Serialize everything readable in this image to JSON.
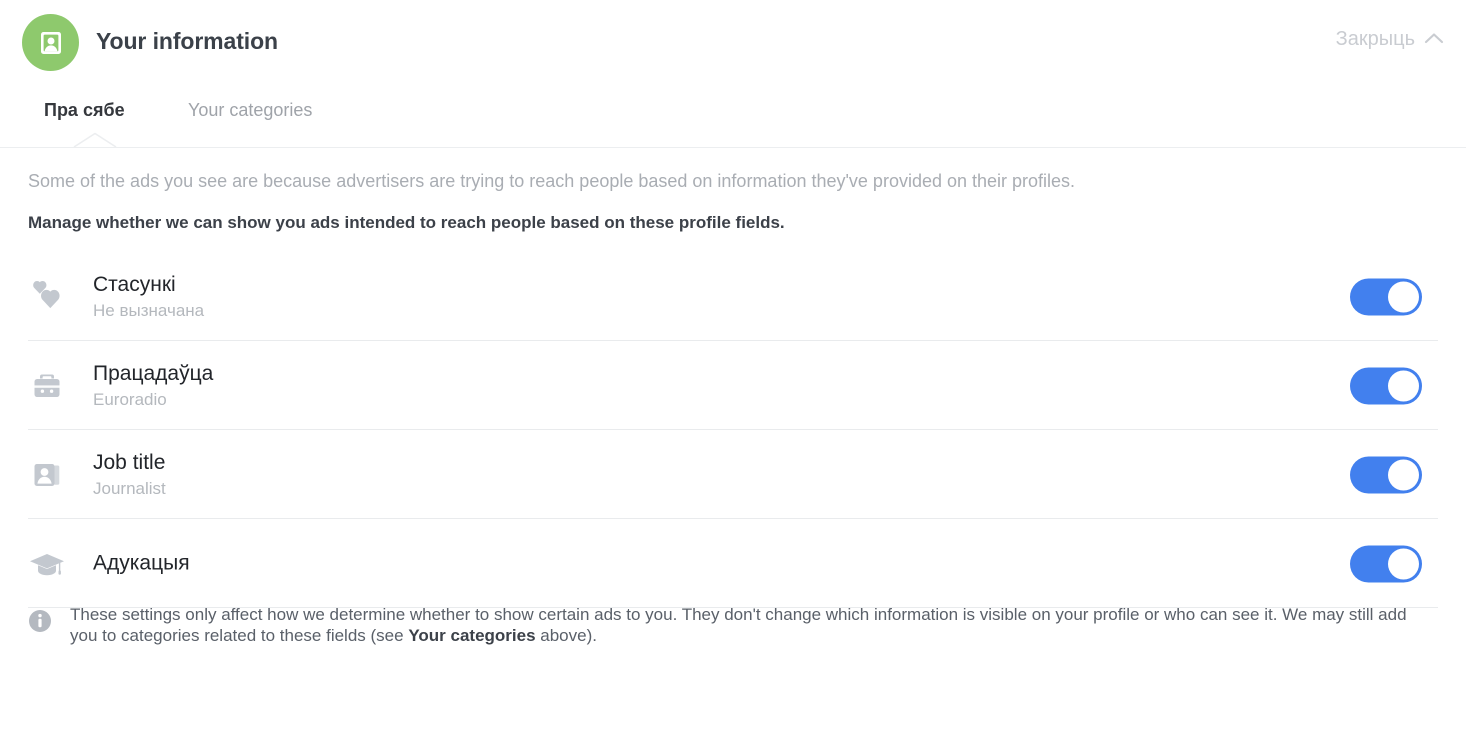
{
  "header": {
    "avatar_icon": "profile-card-icon",
    "avatar_bg": "#8ec96d",
    "title": "Your information",
    "close_label": "Закрыць",
    "close_icon": "chevron-up-icon"
  },
  "tabs": [
    {
      "label": "Пра сябе",
      "active": true
    },
    {
      "label": "Your categories",
      "active": false
    }
  ],
  "intro": {
    "description": "Some of the ads you see are because advertisers are trying to reach people based on information they've provided on their profiles.",
    "subheading": "Manage whether we can show you ads intended to reach people based on these profile fields."
  },
  "rows": [
    {
      "icon": "hearts-icon",
      "title": "Стасункі",
      "subtitle": "Не вызначана",
      "toggle_state": "on"
    },
    {
      "icon": "briefcase-icon",
      "title": "Працадаўца",
      "subtitle": "Euroradio",
      "toggle_state": "on"
    },
    {
      "icon": "id-badge-icon",
      "title": "Job title",
      "subtitle": "Journalist",
      "toggle_state": "on"
    },
    {
      "icon": "graduation-cap-icon",
      "title": "Адукацыя",
      "subtitle": "",
      "toggle_state": "on"
    }
  ],
  "note": {
    "icon": "info-icon",
    "text_part1": "These settings only affect how we determine whether to show certain ads to you. They don't change which information is visible on your profile or who can see it. We may still add you to categories related to these fields (see ",
    "text_bold": "Your categories",
    "text_part2": " above)."
  },
  "colors": {
    "toggle_on": "#4280ee",
    "accent_green": "#8ec96d",
    "text_primary": "#22252a",
    "text_muted": "#b4b8bd",
    "divider": "#e9ebed"
  }
}
